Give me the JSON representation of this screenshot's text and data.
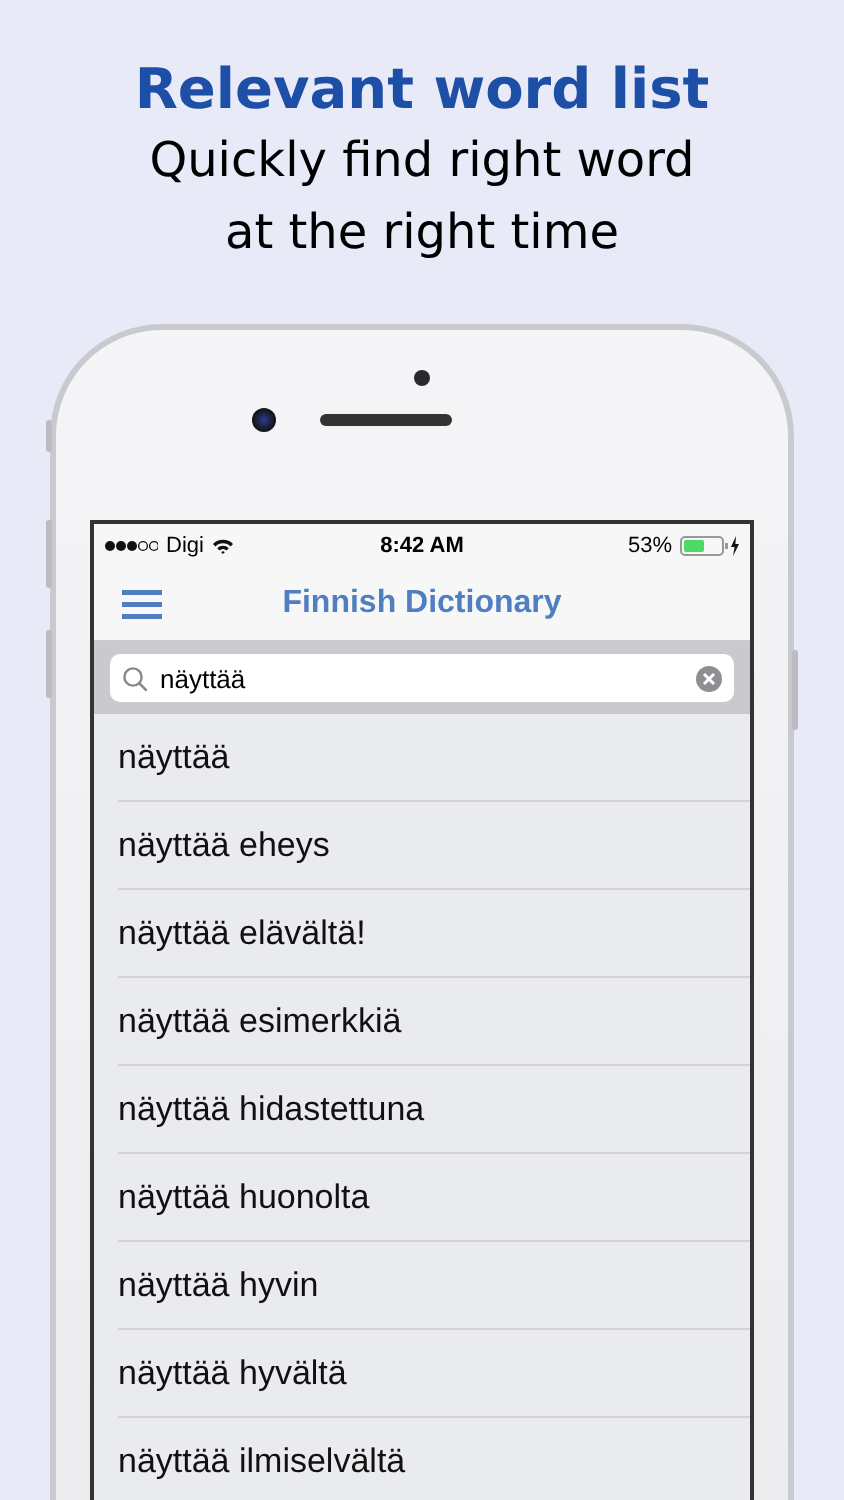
{
  "headline": "Relevant word list",
  "subheadline": [
    "Quickly find right word",
    "at the right time"
  ],
  "status_bar": {
    "carrier": "Digi",
    "time": "8:42 AM",
    "battery": "53%"
  },
  "nav": {
    "title": "Finnish Dictionary"
  },
  "search": {
    "value": "näyttää"
  },
  "results": [
    "näyttää",
    "näyttää eheys",
    "näyttää elävältä!",
    "näyttää esimerkkiä",
    "näyttää hidastettuna",
    "näyttää huonolta",
    "näyttää hyvin",
    "näyttää hyvältä",
    "näyttää ilmiselvältä"
  ]
}
